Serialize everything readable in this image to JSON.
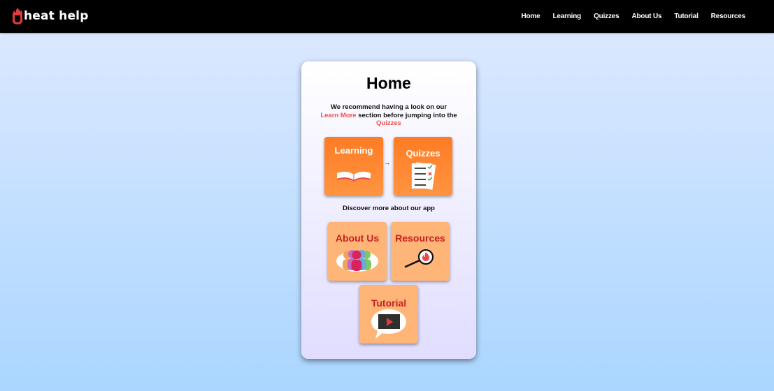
{
  "brand": {
    "name": "heat help"
  },
  "nav": [
    {
      "label": "Home"
    },
    {
      "label": "Learning"
    },
    {
      "label": "Quizzes"
    },
    {
      "label": "About Us"
    },
    {
      "label": "Tutorial"
    },
    {
      "label": "Resources"
    }
  ],
  "home": {
    "title": "Home",
    "intro_before": "We recommend having a look on our",
    "intro_link1": "Learn More",
    "intro_middle": "section before jumping into the",
    "intro_link2": "Quizzes",
    "arrow": "→",
    "discover": "Discover more about our app",
    "tiles": {
      "learning": {
        "label": "Learning",
        "icon": "open-book-icon"
      },
      "quizzes": {
        "label": "Quizzes",
        "icon": "quiz-sheet-icon"
      },
      "about": {
        "label": "About Us",
        "icon": "people-icon"
      },
      "resources": {
        "label": "Resources",
        "icon": "magnifier-flame-icon"
      },
      "tutorial": {
        "label": "Tutorial",
        "icon": "video-speech-bubble-icon"
      }
    }
  },
  "colors": {
    "navbar": "#000000",
    "primary_tile": "#ff7b25",
    "secondary_tile": "#ffb577",
    "link_highlight": "#f24e4e",
    "secondary_label": "#c81e1e"
  }
}
